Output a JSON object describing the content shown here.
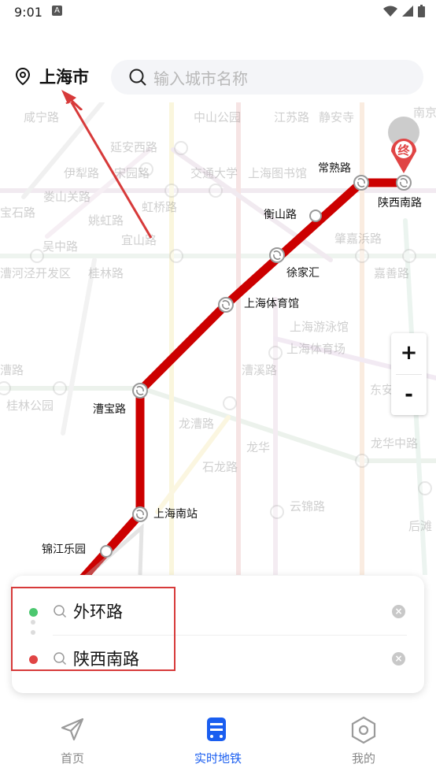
{
  "status_bar": {
    "time": "9:01",
    "badge": "A"
  },
  "header": {
    "city": "上海市",
    "search_placeholder": "输入城市名称"
  },
  "map": {
    "route_color": "#cc0000",
    "end_marker": "终",
    "stations": [
      {
        "name": "常熟路"
      },
      {
        "name": "陕西南路"
      },
      {
        "name": "衡山路"
      },
      {
        "name": "徐家汇"
      },
      {
        "name": "上海体育馆"
      },
      {
        "name": "漕宝路"
      },
      {
        "name": "上海南站"
      },
      {
        "name": "锦江乐园"
      }
    ],
    "background_labels": [
      "咸宁路",
      "中山公园",
      "江苏路",
      "静安寺",
      "南京",
      "延安西路",
      "伊犁路",
      "宋园路",
      "交通大学",
      "上海图书馆",
      "宝石路",
      "娄山关路",
      "姚虹路",
      "虹桥路",
      "宜山路",
      "吴中路",
      "漕河泾开发区",
      "桂林路",
      "肇嘉浜路",
      "嘉善路",
      "上海游泳馆",
      "上海体育场",
      "漕溪路",
      "漕路",
      "桂林公园",
      "东安",
      "龙漕路",
      "石龙路",
      "龙华",
      "龙华中路",
      "云锦路",
      "后滩"
    ]
  },
  "zoom": {
    "in": "+",
    "out": "-"
  },
  "route": {
    "start": "外环路",
    "end": "陕西南路",
    "clear_glyph": "×"
  },
  "tabs": [
    {
      "label": "首页",
      "icon": "paper-plane-icon",
      "active": false
    },
    {
      "label": "实时地铁",
      "icon": "metro-train-icon",
      "active": true
    },
    {
      "label": "我的",
      "icon": "hexagon-profile-icon",
      "active": false
    }
  ],
  "colors": {
    "accent": "#1a5ef0",
    "inactive": "#888888",
    "route": "#cc0000"
  }
}
